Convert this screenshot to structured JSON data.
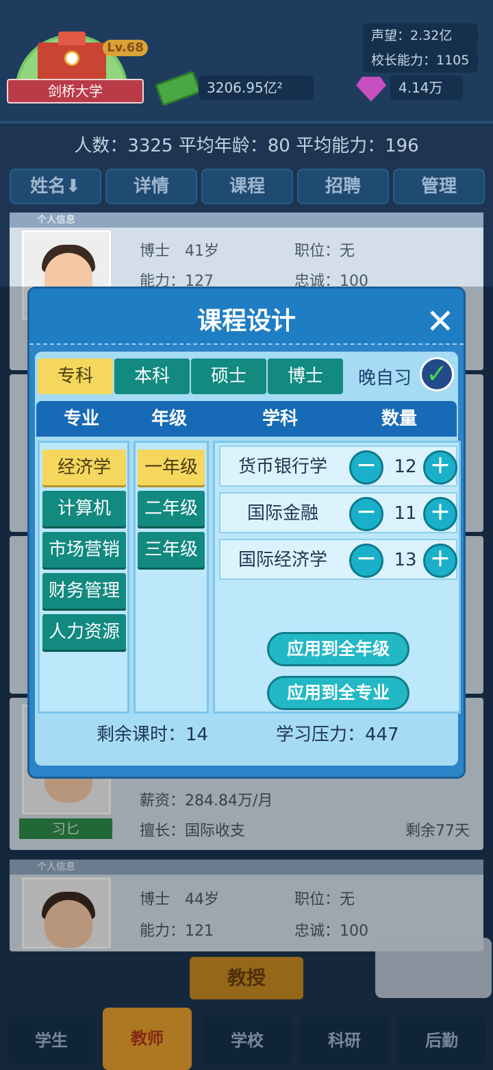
{
  "header": {
    "school_level": "Lv.68",
    "school_name": "剑桥大学",
    "money": "3206.95亿²",
    "reputation_label": "声望：",
    "reputation_value": "2.32亿",
    "principal_ability": "校长能力：1105",
    "gems": "4.14万"
  },
  "summary": "人数：3325 平均年龄：80 平均能力：196",
  "tabs": [
    "姓名⬇",
    "详情",
    "课程",
    "招聘",
    "管理"
  ],
  "teacher_cards": [
    {
      "header": "个人信息",
      "degree_age": "博士　41岁",
      "position": "职位：无",
      "ability": "能力：127",
      "loyalty": "忠诚：100"
    },
    {
      "name": "习匕",
      "salary": "薪资：284.84万/月",
      "specialty": "擅长：国际收支",
      "remaining": "剩余77天"
    },
    {
      "header": "个人信息",
      "degree_age": "博士　44岁",
      "position": "职位：无",
      "ability": "能力：121",
      "loyalty": "忠诚：100"
    }
  ],
  "professor_button": "教授",
  "bottom_nav": [
    "学生",
    "教师",
    "学校",
    "科研",
    "后勤"
  ],
  "dialog": {
    "title": "课程设计",
    "close_icon": "close-icon",
    "levels": [
      "专科",
      "本科",
      "硕士",
      "博士"
    ],
    "self_study_label": "晚自习",
    "self_study_checked": true,
    "columns": [
      "专业",
      "年级",
      "学科",
      "数量"
    ],
    "majors": [
      "经济学",
      "计算机",
      "市场营销",
      "财务管理",
      "人力资源"
    ],
    "grades": [
      "一年级",
      "二年级",
      "三年级"
    ],
    "subjects": [
      {
        "name": "货币银行学",
        "count": "12"
      },
      {
        "name": "国际金融",
        "count": "11"
      },
      {
        "name": "国际经济学",
        "count": "13"
      }
    ],
    "minus_label": "－",
    "plus_label": "＋",
    "apply_all_grades": "应用到全年级",
    "apply_all_majors": "应用到全专业",
    "remaining_hours": "剩余课时：14",
    "study_pressure": "学习压力：447"
  }
}
